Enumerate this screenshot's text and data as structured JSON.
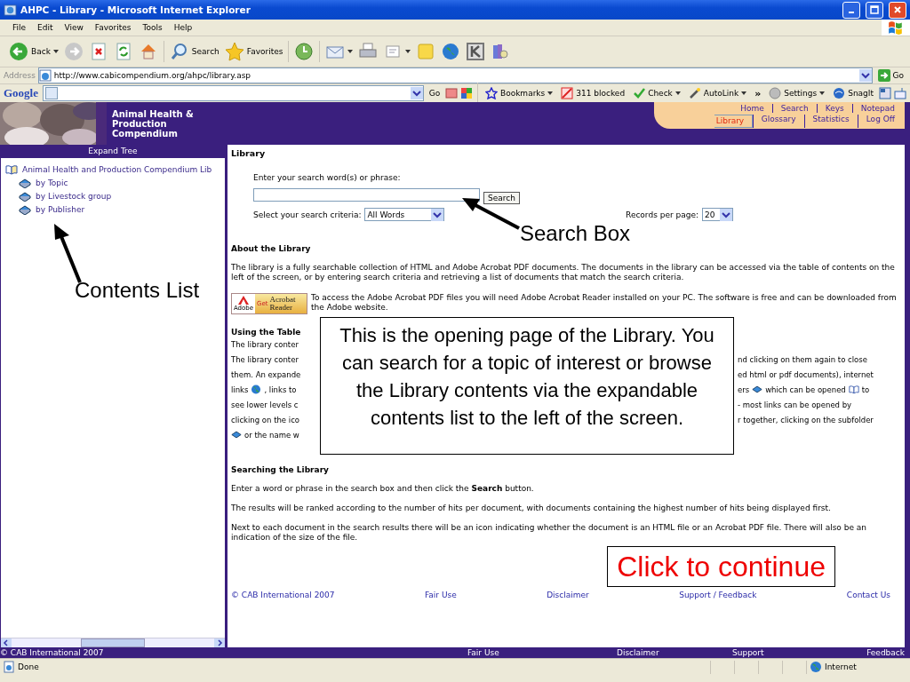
{
  "window": {
    "title": "AHPC - Library - Microsoft Internet Explorer"
  },
  "menu": [
    "File",
    "Edit",
    "View",
    "Favorites",
    "Tools",
    "Help"
  ],
  "toolbar": [
    {
      "kind": "back",
      "label": "Back"
    },
    {
      "kind": "forward"
    },
    {
      "kind": "stop"
    },
    {
      "kind": "refresh"
    },
    {
      "kind": "home"
    },
    {
      "kind": "search",
      "label": "Search"
    },
    {
      "kind": "favorites",
      "label": "Favorites"
    },
    {
      "kind": "history"
    },
    {
      "kind": "mail"
    },
    {
      "kind": "print"
    },
    {
      "kind": "edit"
    },
    {
      "kind": "folder"
    },
    {
      "kind": "globe"
    },
    {
      "kind": "kbox"
    },
    {
      "kind": "books"
    }
  ],
  "address": {
    "label": "Address",
    "value": "http://www.cabicompendium.org/ahpc/library.asp",
    "go": "Go"
  },
  "google_bar": {
    "logo": "Google",
    "go": "Go",
    "items": [
      {
        "kind": "star",
        "label": "Bookmarks",
        "menu": true
      },
      {
        "kind": "blocked",
        "label": "311 blocked",
        "menu": false
      },
      {
        "kind": "spell",
        "label": "Check",
        "menu": true
      },
      {
        "kind": "wand",
        "label": "AutoLink",
        "menu": true
      },
      {
        "kind": "chevron",
        "label": "»",
        "menu": false
      },
      {
        "kind": "ball",
        "label": "Settings",
        "menu": true
      },
      {
        "kind": "swirl",
        "label": "SnagIt",
        "menu": false
      }
    ]
  },
  "site": {
    "title_lines": [
      "Animal Health &",
      "Production",
      "Compendium"
    ],
    "nav": [
      [
        {
          "label": "Home",
          "selected": false
        },
        {
          "label": "Search",
          "selected": false
        },
        {
          "label": "Keys",
          "selected": false
        },
        {
          "label": "Notepad",
          "selected": false
        }
      ],
      [
        {
          "label": "Library",
          "selected": true
        },
        {
          "label": "Glossary",
          "selected": false
        },
        {
          "label": "Statistics",
          "selected": false
        },
        {
          "label": "Log Off",
          "selected": false
        }
      ]
    ]
  },
  "sidebar": {
    "header": "Expand Tree",
    "tree": [
      {
        "label": "Animal Health and Production Compendium Lib",
        "expanded": true,
        "children": [
          {
            "label": "by Topic"
          },
          {
            "label": "by Livestock group"
          },
          {
            "label": "by Publisher"
          }
        ]
      }
    ]
  },
  "content": {
    "heading": "Library",
    "search": {
      "prompt": "Enter your search word(s) or phrase:",
      "button": "Search",
      "criteria_label": "Select your search criteria:",
      "criteria": "All Words",
      "records_label": "Records per page:",
      "records": "20"
    },
    "about": {
      "heading": "About the Library",
      "text": "The library is a fully searchable collection of HTML and Adobe Acrobat PDF documents. The documents in the library can be accessed via the table of contents on the left of the screen, or by entering search criteria and retrieving a list of documents that match the search criteria.",
      "badge": {
        "get": "Get",
        "line1": "Acrobat",
        "line2": "Reader",
        "maker": "Adobe"
      },
      "acrobat_text": "To access the Adobe Acrobat PDF files you will need Adobe Acrobat Reader installed on your PC. The software is free and can be downloaded from the Adobe website."
    },
    "using": {
      "heading": "Using the Table",
      "lines": [
        {
          "left": [
            {
              "kind": "text",
              "text": "The library conter"
            }
          ]
        },
        {
          "left": [
            {
              "kind": "text",
              "text": "The library conter"
            }
          ],
          "right": [
            {
              "kind": "text",
              "text": "nd clicking on them again to close"
            }
          ]
        },
        {
          "left": [
            {
              "kind": "text",
              "text": "them. An expande"
            }
          ],
          "right": [
            {
              "kind": "text",
              "text": "ed html or pdf documents), internet"
            }
          ]
        },
        {
          "left": [
            {
              "kind": "text",
              "text": "links"
            },
            {
              "kind": "globe"
            },
            {
              "kind": "text",
              "text": ", links to"
            }
          ],
          "right": [
            {
              "kind": "text",
              "text": "ers"
            },
            {
              "kind": "book"
            },
            {
              "kind": "text",
              "text": "which can be opened"
            },
            {
              "kind": "openbook"
            },
            {
              "kind": "text",
              "text": "to"
            }
          ]
        },
        {
          "left": [
            {
              "kind": "text",
              "text": "see lower levels c"
            }
          ],
          "right": [
            {
              "kind": "text",
              "text": "- most links can be opened by"
            }
          ]
        },
        {
          "left": [
            {
              "kind": "text",
              "text": "clicking on the ico"
            }
          ],
          "right": [
            {
              "kind": "text",
              "text": "r together, clicking on the subfolder"
            }
          ]
        },
        {
          "left": [
            {
              "kind": "book"
            },
            {
              "kind": "text",
              "text": "or the name w"
            }
          ]
        }
      ]
    },
    "searching": {
      "heading": "Searching the Library",
      "paragraphs": [
        "Enter a word or phrase in the search box and then click the **Search** button.",
        "The results will be ranked according to the number of hits per document, with documents containing the highest number of hits being displayed first.",
        "Next to each document in the search results there will be an icon indicating whether the document is an HTML file or an Acrobat PDF file. There will also be an indication of the size of the file."
      ]
    },
    "footer_links": [
      "© CAB International 2007",
      "Fair Use",
      "Disclaimer",
      "Support / Feedback",
      "Contact Us"
    ]
  },
  "bottom_bar": [
    "© CAB International 2007",
    "Fair Use",
    "Disclaimer",
    "Support",
    "Feedback"
  ],
  "status_bar": {
    "text": "Done",
    "zone": "Internet"
  },
  "annotations": {
    "callout": "This is the opening page of the Library. You can search for a topic of interest or browse the Library contents via the expandable contents list to the left of the screen.",
    "contents_label": "Contents List",
    "search_label": "Search Box",
    "continue": "Click to continue"
  }
}
